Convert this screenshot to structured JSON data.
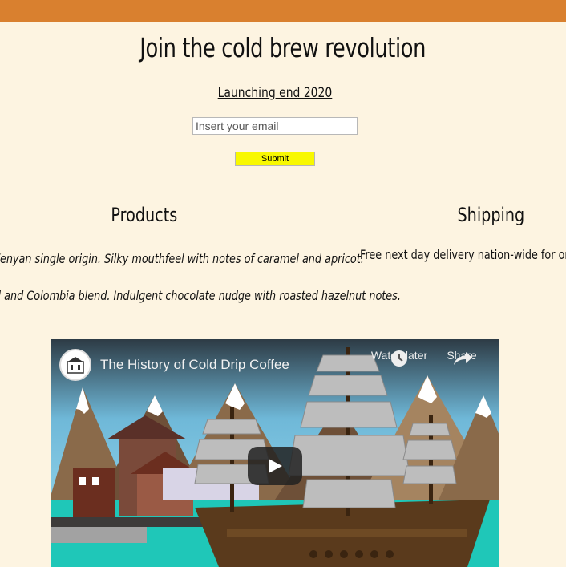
{
  "colors": {
    "background": "#fdf4e1",
    "topbar": "#d9802f",
    "submit": "#f8f800"
  },
  "hero": {
    "headline": "Join the cold brew revolution",
    "launch": "Launching end 2020",
    "email_placeholder": "Insert your email",
    "submit_label": "Submit"
  },
  "products": {
    "heading": "Products",
    "items": [
      "Kenyan single origin. Silky mouthfeel with notes of caramel and apricot.",
      "il and Colombia blend. Indulgent chocolate nudge with roasted hazelnut notes."
    ]
  },
  "shipping": {
    "heading": "Shipping",
    "text": "Free next day delivery nation-wide for orders"
  },
  "video": {
    "title": "The History of Cold Drip Coffee",
    "watch_later": "Watch later",
    "share": "Share",
    "icons": {
      "watch_later": "clock-icon",
      "share": "share-arrow-icon",
      "play": "play-icon"
    }
  }
}
